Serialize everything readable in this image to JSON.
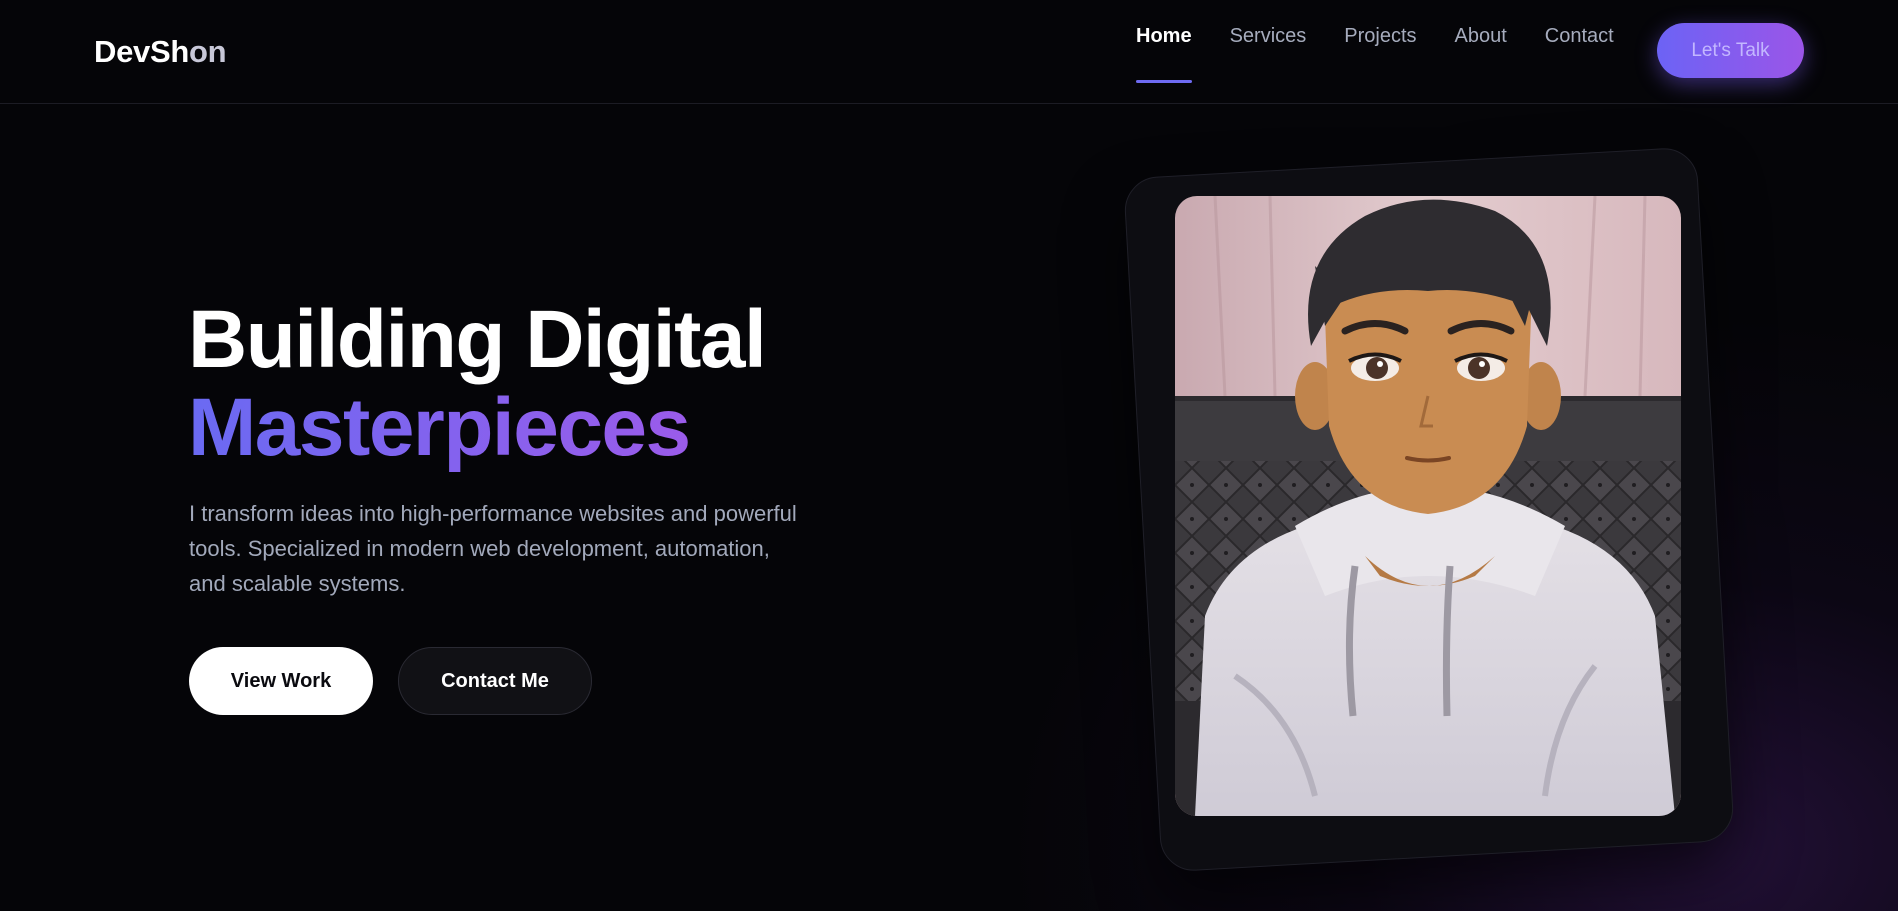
{
  "header": {
    "logo_part1": "DevSh",
    "logo_part2": "on",
    "nav": [
      {
        "label": "Home",
        "active": true
      },
      {
        "label": "Services",
        "active": false
      },
      {
        "label": "Projects",
        "active": false
      },
      {
        "label": "About",
        "active": false
      },
      {
        "label": "Contact",
        "active": false
      }
    ],
    "cta_label": "Let's Talk"
  },
  "hero": {
    "title_line1": "Building Digital",
    "title_line2": "Masterpieces",
    "description": "I transform ideas into high-performance websites and powerful tools. Specialized in modern web development, automation, and scalable systems.",
    "primary_button": "View Work",
    "secondary_button": "Contact Me"
  },
  "colors": {
    "background": "#050508",
    "accent_start": "#6a6af2",
    "accent_end": "#a259e9",
    "muted_text": "#a2a9bb"
  }
}
